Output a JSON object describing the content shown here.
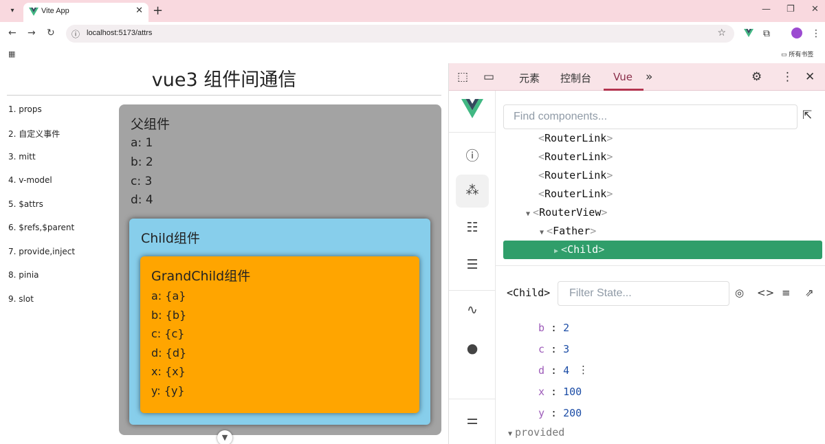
{
  "browser": {
    "tab_title": "Vite App",
    "url": "localhost:5173/attrs",
    "bookmarks_folder": "所有书签"
  },
  "page": {
    "title": "vue3 组件间通信",
    "nav_links": [
      "1. props",
      "2. 自定义事件",
      "3. mitt",
      "4. v-model",
      "5. $attrs",
      "6. $refs,$parent",
      "7. provide,inject",
      "8. pinia",
      "9. slot"
    ],
    "father": {
      "title": "父组件",
      "lines": [
        "a: 1",
        "b: 2",
        "c: 3",
        "d: 4"
      ]
    },
    "child": {
      "title": "Child组件"
    },
    "grandchild": {
      "title": "GrandChild组件",
      "lines": [
        "a: {a}",
        "b: {b}",
        "c: {c}",
        "d: {d}",
        "x: {x}",
        "y: {y}"
      ]
    }
  },
  "devtools": {
    "tabs": [
      "元素",
      "控制台",
      "Vue"
    ],
    "active_tab": "Vue",
    "search_placeholder": "Find components...",
    "tree": [
      {
        "name": "RouterLink",
        "depth": 0,
        "arrow": ""
      },
      {
        "name": "RouterLink",
        "depth": 0,
        "arrow": ""
      },
      {
        "name": "RouterLink",
        "depth": 0,
        "arrow": ""
      },
      {
        "name": "RouterLink",
        "depth": 0,
        "arrow": ""
      },
      {
        "name": "RouterView",
        "depth": 0,
        "arrow": "▼"
      },
      {
        "name": "Father",
        "depth": 1,
        "arrow": "▼"
      },
      {
        "name": "Child",
        "depth": 2,
        "arrow": "▶",
        "selected": true
      }
    ],
    "state": {
      "component": "<Child>",
      "filter_placeholder": "Filter State...",
      "props": [
        {
          "key": "b",
          "value": "2"
        },
        {
          "key": "c",
          "value": "3"
        },
        {
          "key": "d",
          "value": "4"
        },
        {
          "key": "x",
          "value": "100"
        },
        {
          "key": "y",
          "value": "200"
        }
      ],
      "provided_label": "provided"
    }
  },
  "colors": {
    "father_bg": "#a3a3a3",
    "child_bg": "#87ceeb",
    "grandchild_bg": "#ffa500",
    "vue_green": "#2f9e6a",
    "tabstrip_bg": "#f9d9df"
  }
}
